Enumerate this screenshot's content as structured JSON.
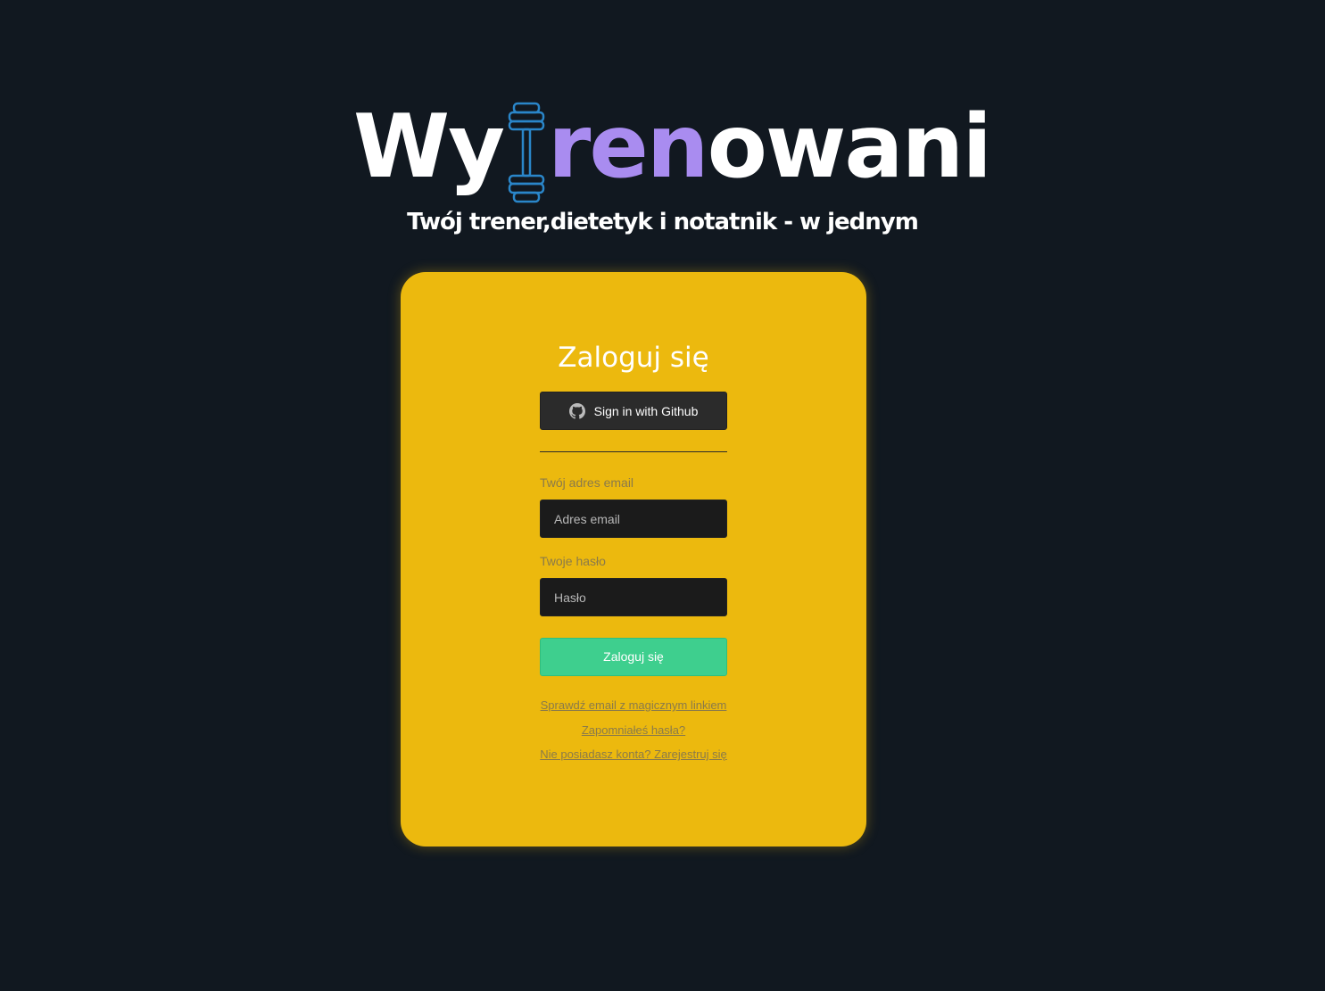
{
  "brand": {
    "part1": "Wy",
    "part2": "ren",
    "part3": "owani",
    "tagline": "Twój trener,dietetyk i notatnik - w jednym",
    "colors": {
      "white": "#ffffff",
      "purple": "#a98cf0",
      "dumbbell": "#2a86c9"
    }
  },
  "login": {
    "title": "Zaloguj się",
    "github_button": "Sign in with Github",
    "email_label": "Twój adres email",
    "email_placeholder": "Adres email",
    "password_label": "Twoje hasło",
    "password_placeholder": "Hasło",
    "submit_label": "Zaloguj się",
    "links": {
      "magic_link": "Sprawdź email z magicznym linkiem",
      "forgot_password": "Zapomniałeś hasła?",
      "register": "Nie posiadasz konta? Zarejestruj się"
    }
  },
  "colors": {
    "background": "#111820",
    "card": "#ecb90e",
    "github_button": "#2b2b2b",
    "submit_button": "#3ecf8e",
    "input_bg": "#1b1b1b"
  }
}
